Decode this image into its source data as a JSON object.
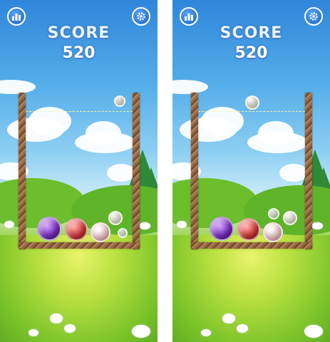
{
  "left_panel": {
    "score_label": "SCORE",
    "score_value": "520",
    "stats_icon": "bar-chart-icon",
    "settings_icon": "gear-icon",
    "orbs": [
      {
        "kind": "purple-rose",
        "color": "#7a2fc4"
      },
      {
        "kind": "red-rose",
        "color": "#d6393a"
      },
      {
        "kind": "pink-rose",
        "color": "#f7cfd3"
      },
      {
        "kind": "white-rose",
        "color": "#f2f2dc"
      },
      {
        "kind": "white-flower",
        "color": "#dff4cf"
      }
    ],
    "next_orb": {
      "kind": "white-bud",
      "color": "#dff4cf"
    }
  },
  "right_panel": {
    "score_label": "SCORE",
    "score_value": "520",
    "stats_icon": "bar-chart-icon",
    "settings_icon": "gear-icon",
    "orbs": [
      {
        "kind": "purple-rose",
        "color": "#7a2fc4"
      },
      {
        "kind": "red-rose",
        "color": "#d6393a"
      },
      {
        "kind": "pink-rose",
        "color": "#f7cfd3"
      },
      {
        "kind": "white-rose",
        "color": "#f2f2dc"
      },
      {
        "kind": "white-bud",
        "color": "#dff4cf"
      }
    ],
    "next_orb": {
      "kind": "white-bud",
      "color": "#dff4cf"
    }
  },
  "colors": {
    "sky_top": "#2f86da",
    "grass": "#7cc62e",
    "wood": "#9a6a45",
    "button": "#1b5fc7",
    "score_text": "#ffffff",
    "line": "#f3f39a"
  }
}
